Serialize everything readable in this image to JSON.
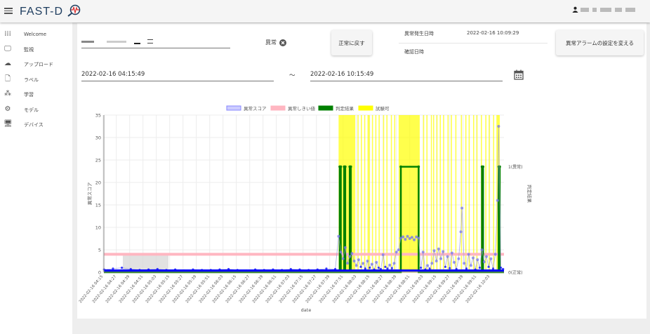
{
  "header": {
    "menu_icon": "hamburger-icon",
    "logo_text": "FAST-D",
    "logo_icon": "magnifier-waveform-icon",
    "user_icon": "person-icon"
  },
  "sidebar": {
    "items": [
      {
        "label": "Welcome",
        "icon": "grid-icon"
      },
      {
        "label": "監視",
        "icon": "monitor-eye-icon"
      },
      {
        "label": "アップロード",
        "icon": "cloud-upload-icon"
      },
      {
        "label": "ラベル",
        "icon": "file-edit-icon"
      },
      {
        "label": "学習",
        "icon": "molecule-icon"
      },
      {
        "label": "モデル",
        "icon": "chip-icon"
      },
      {
        "label": "デバイス",
        "icon": "desktop-icon"
      }
    ]
  },
  "controls": {
    "status_chip": "異常",
    "reset_button": "正常に戻す",
    "occurred_label": "異常発生日時",
    "occurred_value": "2022-02-16 10:09:29",
    "confirmed_label": "確認日時",
    "alarm_settings_button": "異常アラームの設定を変える",
    "start_date": "2022-02-16 04:15:49",
    "range_sep": "〜",
    "end_date": "2022-02-16 10:15:49",
    "calendar_icon": "calendar-icon"
  },
  "colors": {
    "score": "#0000ff",
    "threshold": "#ffb6c1",
    "judgement": "#008000",
    "excluded": "#ffff00"
  },
  "chart_data": {
    "type": "line",
    "date": "2022-02-16",
    "xlabel": "date",
    "ylabel": "異常スコア",
    "y2label": "判定結果",
    "ylim": [
      0,
      35
    ],
    "yticks": [
      0,
      5,
      10,
      15,
      20,
      25,
      30,
      35
    ],
    "y2ticks": [
      {
        "value": 0,
        "label": "0(正常)"
      },
      {
        "value": 1,
        "label": "1(異常)"
      }
    ],
    "xlim": [
      "04:15:49",
      "10:15:49"
    ],
    "xticks": [
      "2022-02-16 04:15",
      "2022-02-16 04:27",
      "2022-02-16 04:39",
      "2022-02-16 04:51",
      "2022-02-16 05:03",
      "2022-02-16 05:15",
      "2022-02-16 05:27",
      "2022-02-16 05:39",
      "2022-02-16 05:51",
      "2022-02-16 06:03",
      "2022-02-16 06:15",
      "2022-02-16 06:27",
      "2022-02-16 06:39",
      "2022-02-16 06:51",
      "2022-02-16 07:03",
      "2022-02-16 07:15",
      "2022-02-16 07:27",
      "2022-02-16 07:39",
      "2022-02-16 07:51",
      "2022-02-16 08:03",
      "2022-02-16 08:15",
      "2022-02-16 08:27",
      "2022-02-16 08:39",
      "2022-02-16 08:51",
      "2022-02-16 09:03",
      "2022-02-16 09:15",
      "2022-02-16 09:27",
      "2022-02-16 09:39",
      "2022-02-16 09:51",
      "2022-02-16 10:03"
    ],
    "legend": [
      "異常スコア",
      "異常しきい値",
      "判定結果",
      "試験可"
    ],
    "legend_position": "top",
    "grid": true,
    "threshold": 4,
    "score": {
      "x": [
        "04:16",
        "04:24",
        "04:32",
        "04:40",
        "04:48",
        "04:56",
        "05:04",
        "05:12",
        "05:20",
        "05:28",
        "05:36",
        "05:44",
        "05:52",
        "06:00",
        "06:08",
        "06:16",
        "06:24",
        "06:32",
        "06:40",
        "06:48",
        "06:56",
        "07:04",
        "07:12",
        "07:20",
        "07:28",
        "07:36",
        "07:44",
        "07:47",
        "07:49",
        "07:51",
        "07:53",
        "07:55",
        "07:57",
        "07:59",
        "08:01",
        "08:03",
        "08:05",
        "08:07",
        "08:09",
        "08:11",
        "08:13",
        "08:15",
        "08:17",
        "08:19",
        "08:21",
        "08:23",
        "08:25",
        "08:27",
        "08:29",
        "08:31",
        "08:33",
        "08:35",
        "08:37",
        "08:39",
        "08:41",
        "08:43",
        "08:45",
        "08:47",
        "08:49",
        "08:51",
        "08:53",
        "08:55",
        "08:57",
        "08:59",
        "09:01",
        "09:03",
        "09:05",
        "09:07",
        "09:09",
        "09:11",
        "09:13",
        "09:15",
        "09:17",
        "09:19",
        "09:21",
        "09:23",
        "09:25",
        "09:27",
        "09:29",
        "09:31",
        "09:33",
        "09:35",
        "09:37",
        "09:38",
        "09:40",
        "09:42",
        "09:44",
        "09:46",
        "09:48",
        "09:50",
        "09:52",
        "09:54",
        "09:56",
        "09:58",
        "10:00",
        "10:02",
        "10:04",
        "10:06",
        "10:08",
        "10:10",
        "10:11",
        "10:13",
        "10:15"
      ],
      "y": [
        0.6,
        0.8,
        1.0,
        0.7,
        0.5,
        0.6,
        0.7,
        0.5,
        0.6,
        0.4,
        0.6,
        0.5,
        0.5,
        0.6,
        0.7,
        0.5,
        0.4,
        0.6,
        0.5,
        0.6,
        0.5,
        0.7,
        0.6,
        0.5,
        0.6,
        0.8,
        0.7,
        8.0,
        4.5,
        3.0,
        5.5,
        2.0,
        3.5,
        4.2,
        2.5,
        1.5,
        2.8,
        1.2,
        2.0,
        0.8,
        2.5,
        1.0,
        1.8,
        0.6,
        2.2,
        1.0,
        0.7,
        3.9,
        1.2,
        0.8,
        1.6,
        0.9,
        2.0,
        4.5,
        5.0,
        7.6,
        7.9,
        7.3,
        8.0,
        7.5,
        7.8,
        7.2,
        7.9,
        7.6,
        1.0,
        4.5,
        0.6,
        1.5,
        0.8,
        2.0,
        4.8,
        2.5,
        5.2,
        3.0,
        4.6,
        1.2,
        3.5,
        0.9,
        4.3,
        2.2,
        0.7,
        3.0,
        9.0,
        14.3,
        2.0,
        0.8,
        4.0,
        1.5,
        3.2,
        0.6,
        2.8,
        1.0,
        5.0,
        2.3,
        3.5,
        1.2,
        3.0,
        0.8,
        4.0,
        16.0,
        32.5,
        1.0,
        0.7
      ]
    },
    "judgement_abnormal": [
      [
        "07:48",
        "07:49"
      ],
      [
        "07:52",
        "07:53"
      ],
      [
        "07:57",
        "07:58"
      ],
      [
        "08:43",
        "08:59"
      ],
      [
        "09:56",
        "09:57"
      ],
      [
        "10:11",
        "10:12"
      ]
    ],
    "excluded_ranges": [
      [
        "07:47",
        "08:02"
      ],
      [
        "08:04",
        "08:05"
      ],
      [
        "08:07",
        "08:08"
      ],
      [
        "08:10",
        "08:11"
      ],
      [
        "08:13",
        "08:15"
      ],
      [
        "08:17",
        "08:18"
      ],
      [
        "08:20",
        "08:21"
      ],
      [
        "08:23",
        "08:24"
      ],
      [
        "08:27",
        "08:28"
      ],
      [
        "08:30",
        "08:31"
      ],
      [
        "08:34",
        "08:35"
      ],
      [
        "08:37",
        "08:38"
      ],
      [
        "08:41",
        "09:00"
      ],
      [
        "09:03",
        "09:04"
      ],
      [
        "09:06",
        "09:07"
      ],
      [
        "09:10",
        "09:11"
      ],
      [
        "09:12",
        "09:13"
      ],
      [
        "09:15",
        "09:16"
      ],
      [
        "09:18",
        "09:19"
      ],
      [
        "09:21",
        "09:22"
      ],
      [
        "09:25",
        "09:26"
      ],
      [
        "09:28",
        "09:29"
      ],
      [
        "09:32",
        "09:33"
      ],
      [
        "09:37",
        "09:38"
      ],
      [
        "09:41",
        "09:42"
      ],
      [
        "09:44",
        "09:45"
      ],
      [
        "09:48",
        "09:49"
      ],
      [
        "09:51",
        "09:52"
      ],
      [
        "09:55",
        "09:56"
      ],
      [
        "09:59",
        "10:00"
      ],
      [
        "10:02",
        "10:03"
      ],
      [
        "10:06",
        "10:07"
      ],
      [
        "10:09",
        "10:12"
      ]
    ]
  }
}
